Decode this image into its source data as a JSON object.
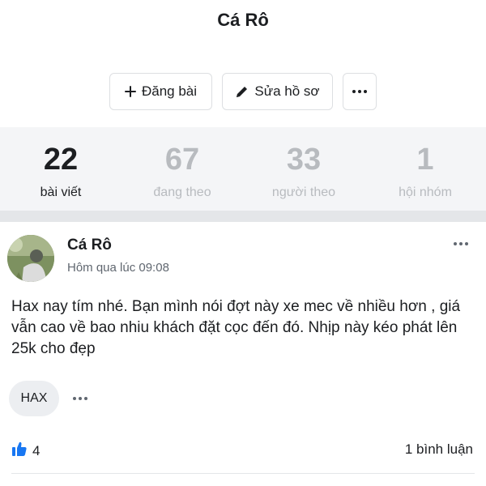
{
  "header": {
    "title": "Cá Rô"
  },
  "actions": {
    "post_label": "Đăng bài",
    "edit_label": "Sửa hồ sơ",
    "more_icon": "more-horizontal-icon"
  },
  "stats": [
    {
      "value": "22",
      "label": "bài viết"
    },
    {
      "value": "67",
      "label": "đang theo"
    },
    {
      "value": "33",
      "label": "người theo"
    },
    {
      "value": "1",
      "label": "hội nhóm"
    }
  ],
  "post": {
    "author": "Cá Rô",
    "timestamp": "Hôm qua lúc 09:08",
    "body": "Hax nay tím nhé. Bạn mình nói đợt này xe mec về nhiều hơn , giá vẫn cao về bao nhiu khách đặt cọc đến đó. Nhịp này kéo phát lên 25k cho đẹp",
    "tag": "HAX",
    "like_count": "4",
    "comments": "1 bình luận"
  },
  "colors": {
    "accent": "#1877f2",
    "muted": "#b8bbbf",
    "band": "#f4f5f7"
  }
}
